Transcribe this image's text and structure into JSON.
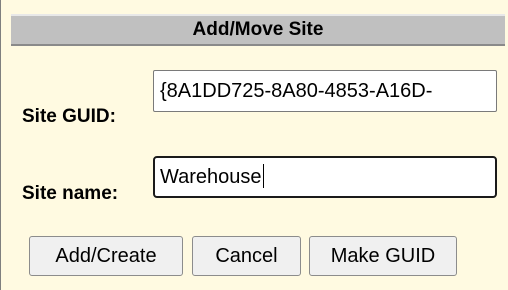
{
  "dialog": {
    "title": "Add/Move Site"
  },
  "form": {
    "guid_label": "Site GUID:",
    "guid_value": "{8A1DD725-8A80-4853-A16D-",
    "name_label": "Site name:",
    "name_value": "Warehouse"
  },
  "buttons": {
    "add_label": "Add/Create",
    "cancel_label": "Cancel",
    "make_guid_label": "Make GUID"
  },
  "colors": {
    "panel_background": "#fffae1",
    "title_bar": "#c0c0c0",
    "button_face": "#f0f0f0"
  }
}
